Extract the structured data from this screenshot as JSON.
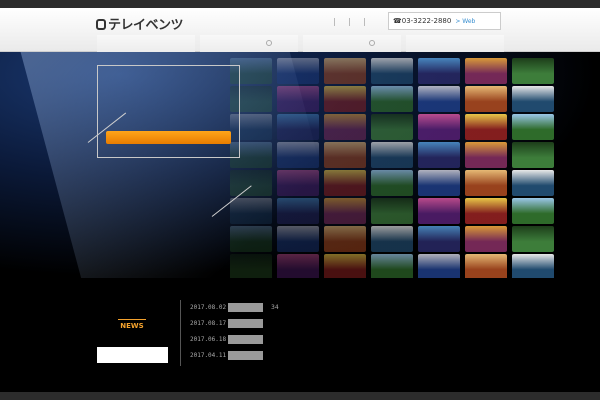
{
  "header": {
    "logo_text": "テレイベンツ",
    "phone": "03-3222-2880",
    "web_label": "Web"
  },
  "nav": {
    "items": [
      {
        "label": ""
      },
      {
        "label": ""
      },
      {
        "label": ""
      },
      {
        "label": ""
      }
    ]
  },
  "news": {
    "title": "NEWS",
    "items": [
      {
        "date": "2017.08.02",
        "extra": "34"
      },
      {
        "date": "2017.08.17",
        "extra": ""
      },
      {
        "date": "2017.06.18",
        "extra": ""
      },
      {
        "date": "2017.04.11",
        "extra": ""
      }
    ]
  },
  "colors": {
    "accent": "#f39217",
    "header_bg": "#f2f2f2",
    "background": "#000000"
  }
}
